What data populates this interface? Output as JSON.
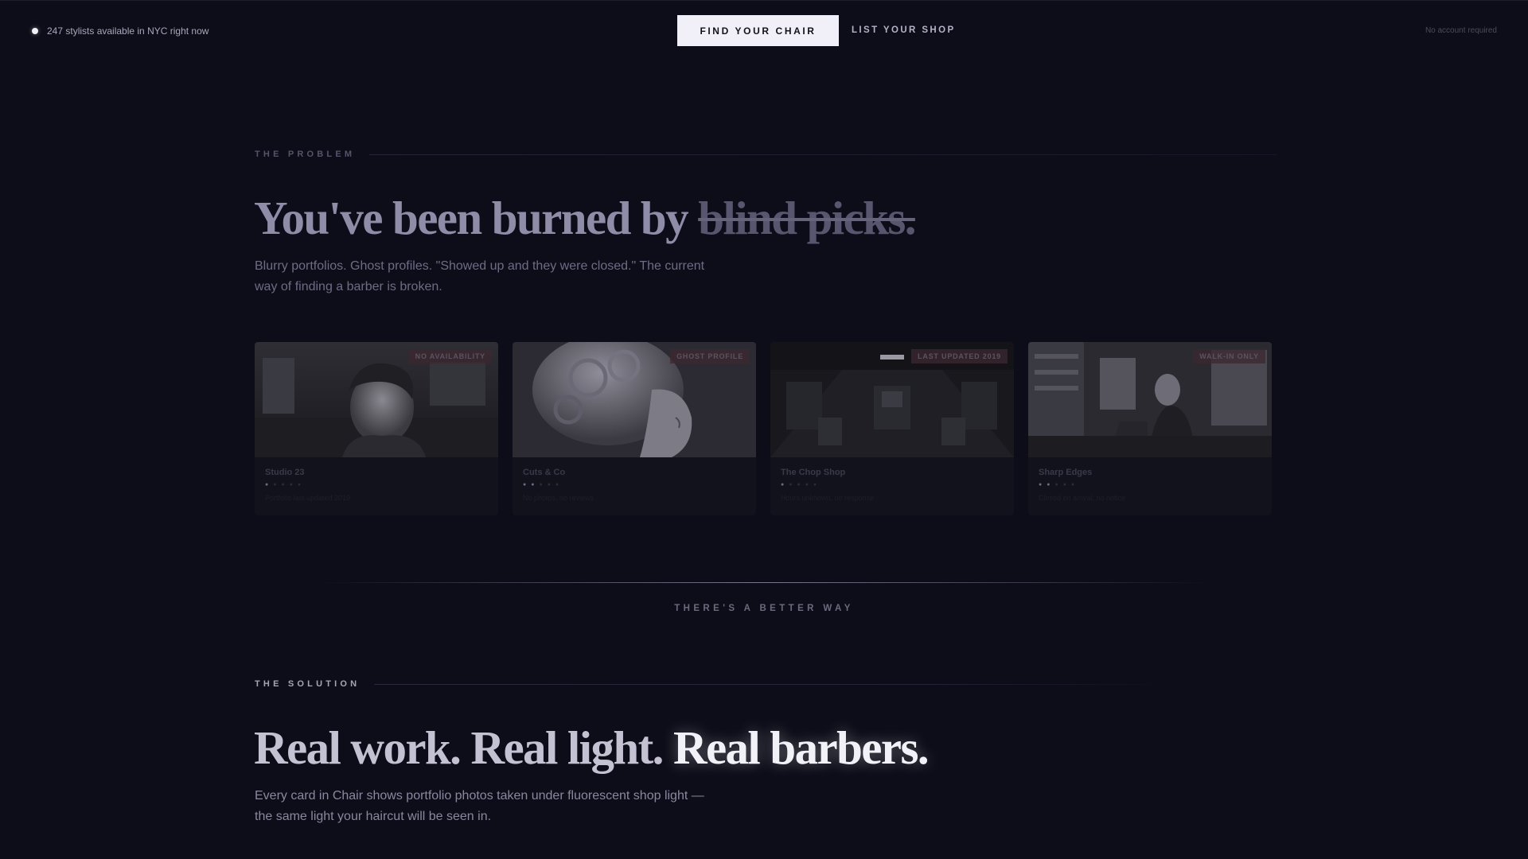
{
  "topbar": {
    "live_text": "247 stylists available in NYC right now",
    "primary_cta": "FIND YOUR CHAIR",
    "secondary_cta": "LIST YOUR SHOP",
    "note": "No account required"
  },
  "problem": {
    "label": "THE PROBLEM",
    "heading_lead": "You've been burned by ",
    "heading_strike": "blind picks.",
    "body": "Blurry portfolios. Ghost profiles. \"Showed up and they were closed.\" The current way of finding a barber is broken."
  },
  "cards": [
    {
      "badge": "NO AVAILABILITY",
      "name": "Studio 23",
      "rating": 1,
      "sub": "Portfolio last updated 2019",
      "photo": "barber-portrait"
    },
    {
      "badge": "GHOST PROFILE",
      "name": "Cuts & Co",
      "rating": 2,
      "sub": "No photos, no reviews",
      "photo": "styled-hair-portrait"
    },
    {
      "badge": "LAST UPDATED 2019",
      "name": "The Chop Shop",
      "rating": 1,
      "sub": "Hours unknown, no response",
      "photo": "empty-salon"
    },
    {
      "badge": "WALK-IN ONLY",
      "name": "Sharp Edges",
      "rating": 2,
      "sub": "Closed on arrival, no notice",
      "photo": "barbershop-interior"
    }
  ],
  "transition": {
    "text": "THERE'S A BETTER WAY"
  },
  "solution": {
    "label": "THE SOLUTION",
    "heading_a": "Real work. ",
    "heading_b": "Real light. ",
    "heading_c": "Real barbers.",
    "body": "Every card in Chair shows portfolio photos taken under fluorescent shop light — the same light your haircut will be seen in."
  },
  "colors": {
    "background": "#0d0d19",
    "cta_bg": "#f1f0f8",
    "badge_bg": "#3c2830"
  }
}
